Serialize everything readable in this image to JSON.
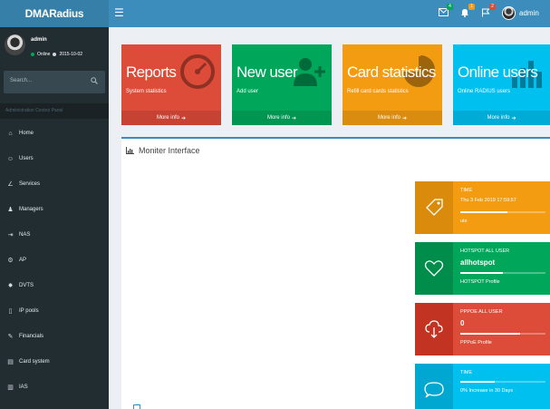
{
  "app": {
    "logo": "DMARadius"
  },
  "topnav": {
    "user_name": "admin",
    "icons": [
      {
        "name": "envelope-icon",
        "badge": "4",
        "badge_color": "#00a65a"
      },
      {
        "name": "bell-icon",
        "badge": "1",
        "badge_color": "#f39c12"
      },
      {
        "name": "flag-icon",
        "badge": "2",
        "badge_color": "#dd4b39"
      }
    ]
  },
  "sidebar": {
    "username": "admin",
    "status": "Online",
    "date": "2015-10-02",
    "search_placeholder": "Search...",
    "header": "Administration Control Panel",
    "items": [
      {
        "label": "Home",
        "icon": "home-icon"
      },
      {
        "label": "Users",
        "icon": "users-icon"
      },
      {
        "label": "Services",
        "icon": "services-icon"
      },
      {
        "label": "Managers",
        "icon": "manager-icon"
      },
      {
        "label": "NAS",
        "icon": "nas-icon"
      },
      {
        "label": "AP",
        "icon": "ap-icon"
      },
      {
        "label": "DVTS",
        "icon": "dvts-icon"
      },
      {
        "label": "IP pools",
        "icon": "ip-pools-icon"
      },
      {
        "label": "Financials",
        "icon": "financials-icon"
      },
      {
        "label": "Card system",
        "icon": "card-system-icon"
      },
      {
        "label": "IAS",
        "icon": "ias-icon"
      }
    ]
  },
  "boxes": [
    {
      "title": "Reports",
      "subtitle": "System statistics",
      "footer": "More info",
      "color": "#dd4b39",
      "icon": "dashboard-gauge-icon"
    },
    {
      "title": "New user",
      "subtitle": "Add user",
      "footer": "More info",
      "color": "#00a65a",
      "icon": "user-plus-icon"
    },
    {
      "title": "Card statistics",
      "subtitle": "Refill card cards statistics",
      "footer": "More info",
      "color": "#f39c12",
      "icon": "pie-chart-icon"
    },
    {
      "title": "Online users",
      "subtitle": "Online RADIUS users",
      "footer": "More info",
      "color": "#00c0ef",
      "icon": "bar-chart-icon"
    }
  ],
  "panel": {
    "title": "Moniter Interface"
  },
  "info_boxes": [
    {
      "title": "TIME",
      "number": "Thu 3 Feb 2019 17:59:57",
      "progress": 0.55,
      "description": "ute",
      "color": "#f39c12",
      "icon": "tag-icon"
    },
    {
      "title": "HOTSPOT ALL USER",
      "number": "allhotspot",
      "progress": 0.5,
      "description": "HOTSPOT Profile",
      "color": "#00a65a",
      "icon": "heart-icon"
    },
    {
      "title": "PPPOE ALL USER",
      "number": "0",
      "progress": 0.7,
      "description": "PPPoE Profile",
      "color": "#dd4b39",
      "icon": "cloud-download-icon"
    },
    {
      "title": "TIME",
      "number": "",
      "progress": 0.4,
      "description": "0% Increase in 30 Days",
      "color": "#00c0ef",
      "icon": "comment-icon"
    }
  ]
}
